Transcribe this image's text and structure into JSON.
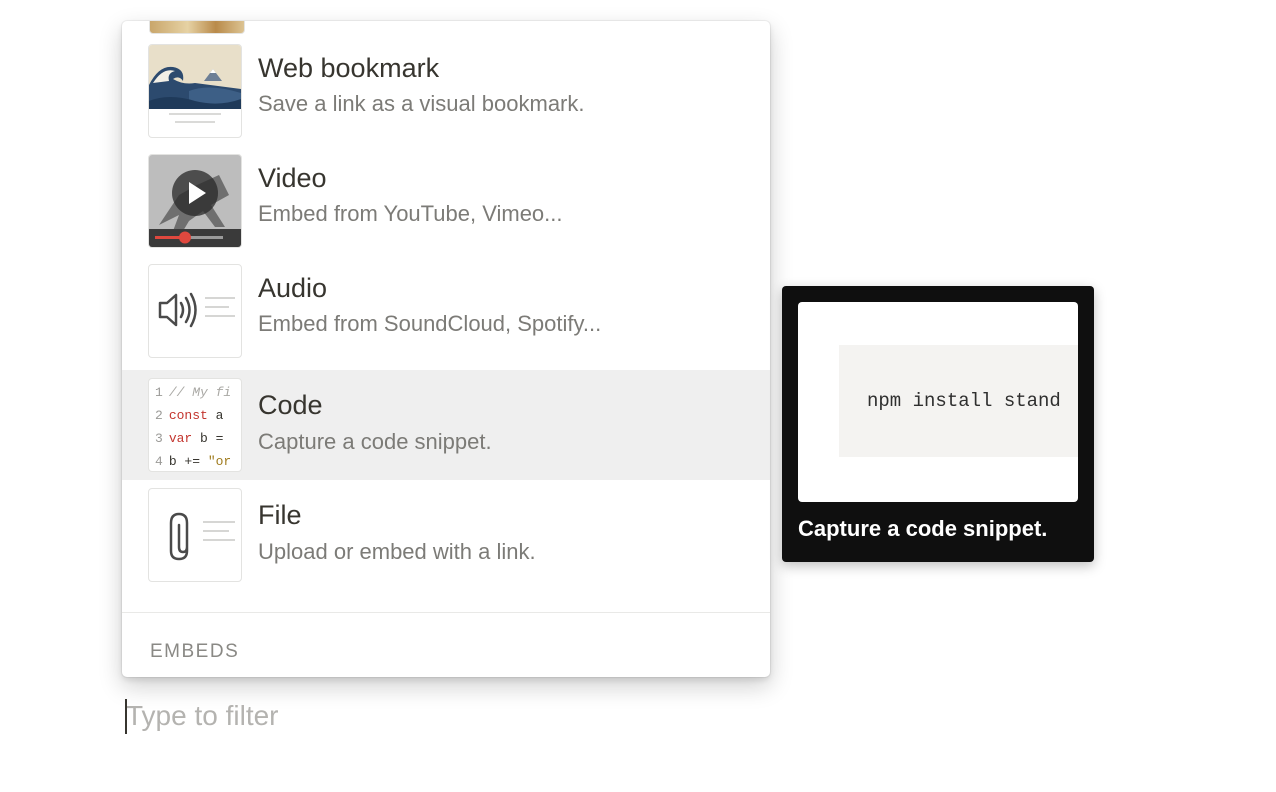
{
  "menu": {
    "items": [
      {
        "title": "Web bookmark",
        "description": "Save a link as a visual bookmark.",
        "icon": "web-bookmark-icon"
      },
      {
        "title": "Video",
        "description": "Embed from YouTube, Vimeo...",
        "icon": "video-icon"
      },
      {
        "title": "Audio",
        "description": "Embed from SoundCloud, Spotify...",
        "icon": "audio-icon"
      },
      {
        "title": "Code",
        "description": "Capture a code snippet.",
        "icon": "code-icon",
        "selected": true
      },
      {
        "title": "File",
        "description": "Upload or embed with a link.",
        "icon": "file-icon"
      }
    ],
    "section_label": "EMBEDS",
    "code_thumbnail_lines": [
      {
        "num": "1",
        "text": "// My fi"
      },
      {
        "num": "2",
        "kw": "const",
        "text": " a"
      },
      {
        "num": "3",
        "kw": "var",
        "text": " b ="
      },
      {
        "num": "4",
        "text": "b += ",
        "str": "\"or"
      }
    ]
  },
  "tooltip": {
    "preview_code": "npm install stand",
    "caption": "Capture a code snippet."
  },
  "filter": {
    "placeholder": "Type to filter",
    "value": ""
  },
  "colors": {
    "selected_row": "#efefef",
    "tooltip_bg": "#0f0f0f",
    "title_text": "#37352f",
    "description_text": "#7c7b77",
    "video_progress": "#e0483e"
  }
}
